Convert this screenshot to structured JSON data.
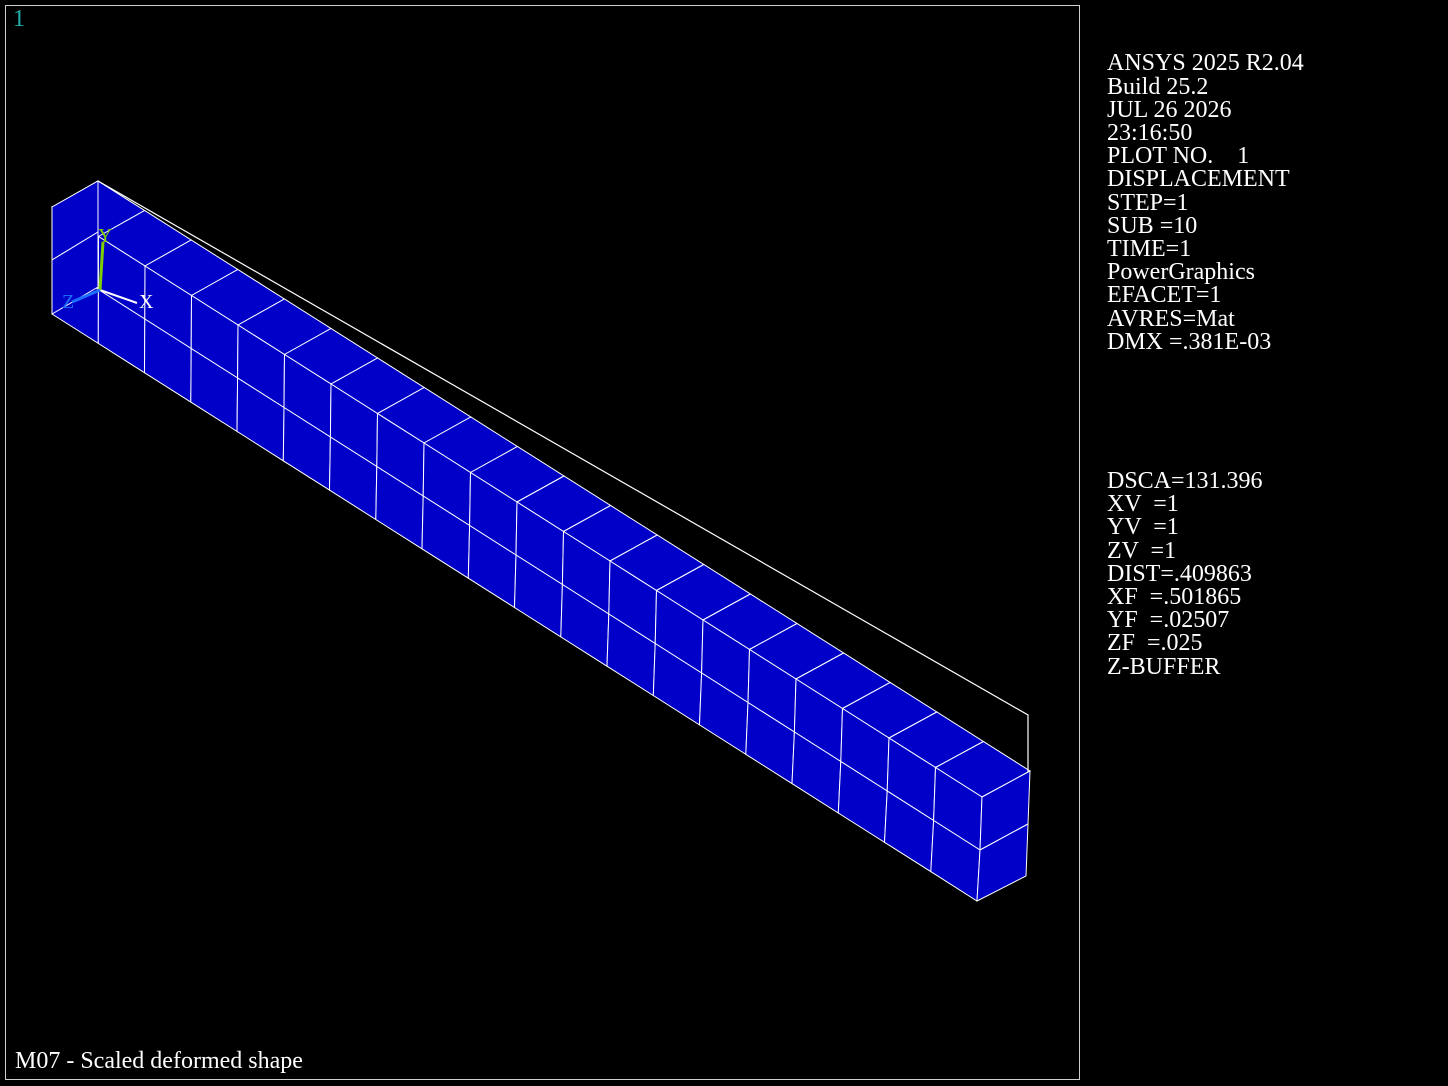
{
  "viewport": {
    "window_number": "1"
  },
  "triad": {
    "x_label": "X",
    "y_label": "Y",
    "z_label": "Z"
  },
  "info_panel": {
    "lines_top": [
      "ANSYS 2025 R2.04",
      "Build 25.2",
      "JUL 26 2026",
      "23:16:50",
      "PLOT NO.    1",
      "DISPLACEMENT",
      "STEP=1",
      "SUB =10",
      "TIME=1",
      "PowerGraphics",
      "EFACET=1",
      "AVRES=Mat",
      "DMX =.381E-03"
    ],
    "lines_bottom": [
      "DSCA=131.396",
      "XV  =1",
      "YV  =1",
      "ZV  =1",
      "DIST=.409863",
      "XF  =.501865",
      "YF  =.02507",
      "ZF  =.025",
      "Z-BUFFER"
    ]
  },
  "caption": "M07 - Scaled deformed shape",
  "colors": {
    "background": "#000000",
    "mesh_fill": "#0000c8",
    "mesh_edges": "#ffffff",
    "window_number": "#20b2aa",
    "triad_x": "#ffffff",
    "triad_y": "#7fd000",
    "triad_z": "#1e6fff"
  }
}
